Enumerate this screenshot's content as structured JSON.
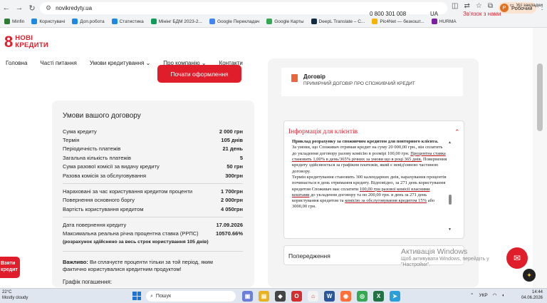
{
  "browser": {
    "url": "novikredyty.ua",
    "profile_label": "Робочий",
    "profile_initial": "Р",
    "bookmarks": [
      {
        "label": "Minfin",
        "color": "#2e7d32"
      },
      {
        "label": "Користувачі",
        "color": "#1e88e5"
      },
      {
        "label": "Доп.робота",
        "color": "#1e88e5"
      },
      {
        "label": "Статистика",
        "color": "#1e88e5"
      },
      {
        "label": "Мінінг БДМ 2023-2...",
        "color": "#0f9d58"
      },
      {
        "label": "Google Перекладач",
        "color": "#4285f4"
      },
      {
        "label": "Google Карты",
        "color": "#34a853"
      },
      {
        "label": "DeepL Translate – С...",
        "color": "#0f2b46"
      },
      {
        "label": "Pic4Net — безкошт...",
        "color": "#f4b400"
      },
      {
        "label": "HURMA",
        "color": "#7b1fa2"
      }
    ],
    "all_bookmarks_label": "Усі закладки"
  },
  "header": {
    "logo_line1": "НОВІ",
    "logo_line2": "КРЕДИТИ",
    "phone": "0 800 301 008",
    "lang": "UA",
    "callback": "Зв'язок з нами"
  },
  "nav": {
    "items": [
      "Головна",
      "Часті питання",
      "Умови кредитування",
      "Про компанію",
      "Контакти"
    ]
  },
  "apply_button": "Почати оформлення",
  "conditions": {
    "title": "Умови вашого договору",
    "rows1": [
      {
        "label": "Сума кредиту",
        "value": "2 000 грн"
      },
      {
        "label": "Термін",
        "value": "105 днів"
      },
      {
        "label": "Періодичність платежів",
        "value": "21 день"
      },
      {
        "label": "Загальна кількість платежів",
        "value": "5"
      },
      {
        "label": "Сума разової комісії за видачу кредиту",
        "value": "50 грн"
      },
      {
        "label": "Разова комісія за обслуговування",
        "value": "300грн"
      }
    ],
    "rows2": [
      {
        "label": "Нараховані за час користування кредитом проценти",
        "value": "1 700грн"
      },
      {
        "label": "Повернення основного боргу",
        "value": "2 000грн"
      },
      {
        "label": "Вартість користування кредитом",
        "value": "4 050грн"
      }
    ],
    "rows3": [
      {
        "label": "Дата повернення кредиту",
        "value": "17.09.2026"
      },
      {
        "label": "Максимальна реальна річна процентна ставка (РРПС)",
        "value": "10570.66%"
      }
    ],
    "rpps_note": "(розрахунок здійснено за весь строк користування 105 днів)"
  },
  "important": {
    "bold": "Важливо:",
    "text": " Ви сплачуєте проценти тільки за той період, яким фактично користувалися кредитним продуктом!"
  },
  "schedule_title": "Графік погашення:",
  "side_button": {
    "line1": "Взяти",
    "line2": "кредит"
  },
  "document": {
    "title": "Договір",
    "subtitle": "ПРИМІРНИЙ ДОГОВІР ПРО СПОЖИВЧИЙ КРЕДИТ"
  },
  "info": {
    "title": "Інформація для клієнтів",
    "example_title": "Приклад розрахунку за споживчим кредитом для повторного клієнта.",
    "p1a": "За умови, що Споживач отримав кредит на суму 20 000,00 грн., він сплатить до укладення договору разову комісію в розмірі 100,00 грн. ",
    "p1u": "Процентна ставка становить 1,00% в день/365% річних за умови що в році 365 днів.",
    "p1b": " Повернення кредиту здійснюється за графіком платежів, який є невід'ємною частиною договору.",
    "p2a": "Термін кредитування становить 300 календарних днів, нарахування процентів починається в день отримання кредиту. Відповідно, за 271 день користування кредитом Споживач має сплатити ",
    "p2u1": "100,00 грн разової комісії власними коштами",
    "p2b": " до укладення договору та по 200,00 грн. в день за 271 день користування кредитом та ",
    "p2u2": "комісію за обслуговування кредитом 15%",
    "p2c": " або 3000,00 грн."
  },
  "warnings_title": "Попередження",
  "watermark": {
    "line1": "Активація Windows",
    "line2": "Щоб активувати Windows, перейдіть у \"Настройки\"."
  },
  "taskbar": {
    "temp": "22°C",
    "weather": "Mostly cloudy",
    "search": "Пошук",
    "lang": "УКР",
    "time": "14:44",
    "date": "04.06.2026"
  }
}
